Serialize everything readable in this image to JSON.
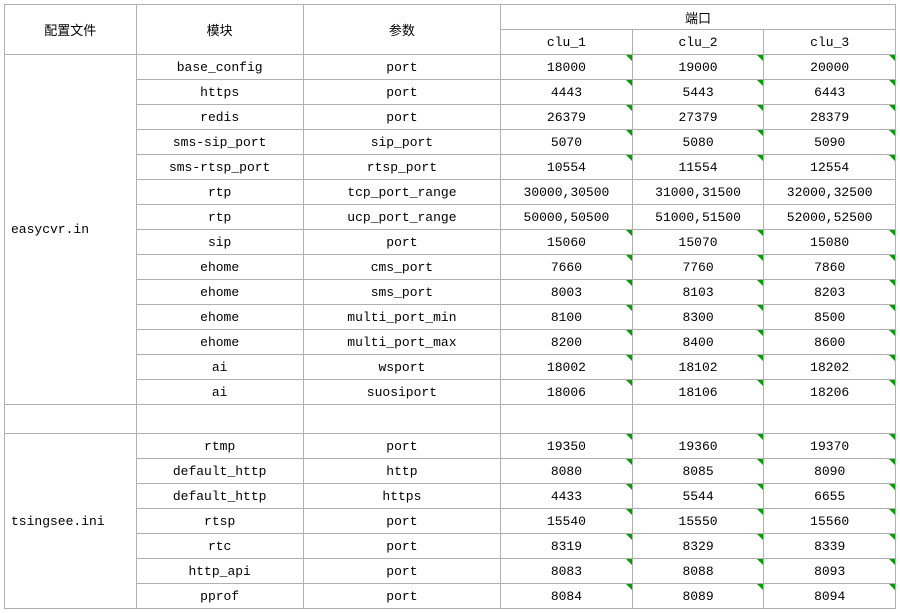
{
  "headers": {
    "config_file": "配置文件",
    "module": "模块",
    "param": "参数",
    "port_group": "端口",
    "clu1": "clu_1",
    "clu2": "clu_2",
    "clu3": "clu_3"
  },
  "groups": [
    {
      "config": "easycvr.in",
      "rows": [
        {
          "module": "base_config",
          "param": "port",
          "c1": "18000",
          "c2": "19000",
          "c3": "20000",
          "flag": true
        },
        {
          "module": "https",
          "param": "port",
          "c1": "4443",
          "c2": "5443",
          "c3": "6443",
          "flag": true
        },
        {
          "module": "redis",
          "param": "port",
          "c1": "26379",
          "c2": "27379",
          "c3": "28379",
          "flag": true
        },
        {
          "module": "sms-sip_port",
          "param": "sip_port",
          "c1": "5070",
          "c2": "5080",
          "c3": "5090",
          "flag": true
        },
        {
          "module": "sms-rtsp_port",
          "param": "rtsp_port",
          "c1": "10554",
          "c2": "11554",
          "c3": "12554",
          "flag": true
        },
        {
          "module": "rtp",
          "param": "tcp_port_range",
          "c1": "30000,30500",
          "c2": "31000,31500",
          "c3": "32000,32500",
          "flag": false
        },
        {
          "module": "rtp",
          "param": "ucp_port_range",
          "c1": "50000,50500",
          "c2": "51000,51500",
          "c3": "52000,52500",
          "flag": false
        },
        {
          "module": "sip",
          "param": "port",
          "c1": "15060",
          "c2": "15070",
          "c3": "15080",
          "flag": true
        },
        {
          "module": "ehome",
          "param": "cms_port",
          "c1": "7660",
          "c2": "7760",
          "c3": "7860",
          "flag": true
        },
        {
          "module": "ehome",
          "param": "sms_port",
          "c1": "8003",
          "c2": "8103",
          "c3": "8203",
          "flag": true
        },
        {
          "module": "ehome",
          "param": "multi_port_min",
          "c1": "8100",
          "c2": "8300",
          "c3": "8500",
          "flag": true
        },
        {
          "module": "ehome",
          "param": "multi_port_max",
          "c1": "8200",
          "c2": "8400",
          "c3": "8600",
          "flag": true
        },
        {
          "module": "ai",
          "param": "wsport",
          "c1": "18002",
          "c2": "18102",
          "c3": "18202",
          "flag": true
        },
        {
          "module": "ai",
          "param": "suosiport",
          "c1": "18006",
          "c2": "18106",
          "c3": "18206",
          "flag": true
        }
      ]
    },
    {
      "config": "tsingsee.ini",
      "rows": [
        {
          "module": "rtmp",
          "param": "port",
          "c1": "19350",
          "c2": "19360",
          "c3": "19370",
          "flag": true
        },
        {
          "module": "default_http",
          "param": "http",
          "c1": "8080",
          "c2": "8085",
          "c3": "8090",
          "flag": true
        },
        {
          "module": "default_http",
          "param": "https",
          "c1": "4433",
          "c2": "5544",
          "c3": "6655",
          "flag": true
        },
        {
          "module": "rtsp",
          "param": "port",
          "c1": "15540",
          "c2": "15550",
          "c3": "15560",
          "flag": true
        },
        {
          "module": "rtc",
          "param": "port",
          "c1": "8319",
          "c2": "8329",
          "c3": "8339",
          "flag": true
        },
        {
          "module": "http_api",
          "param": "port",
          "c1": "8083",
          "c2": "8088",
          "c3": "8093",
          "flag": true
        },
        {
          "module": "pprof",
          "param": "port",
          "c1": "8084",
          "c2": "8089",
          "c3": "8094",
          "flag": true
        }
      ]
    }
  ]
}
